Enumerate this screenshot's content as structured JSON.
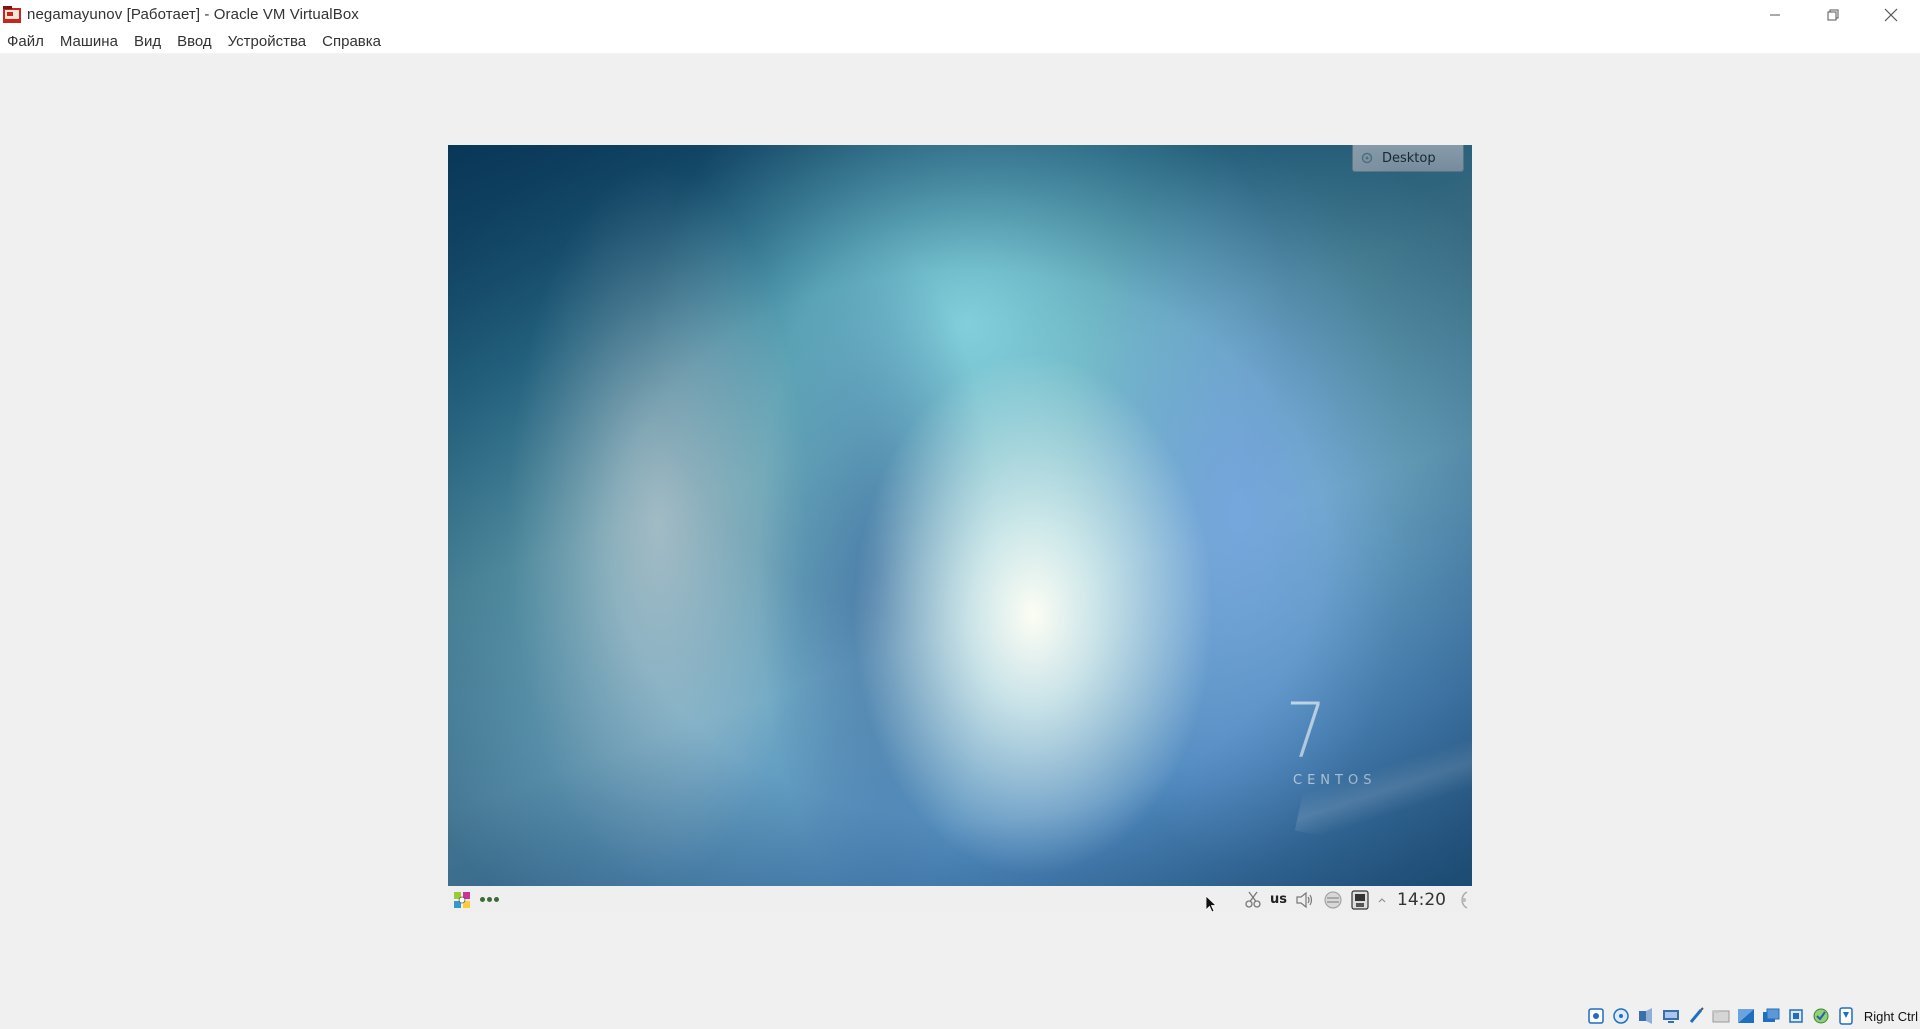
{
  "window": {
    "title": "negamayunov [Работает] - Oracle VM VirtualBox",
    "icon": "virtualbox-icon"
  },
  "menu": {
    "items": [
      "Файл",
      "Машина",
      "Вид",
      "Ввод",
      "Устройства",
      "Справка"
    ]
  },
  "guest": {
    "desktop_button_label": "Desktop",
    "wallpaper_version": "7",
    "wallpaper_brand": "CENTOS",
    "keyboard_layout": "us",
    "clock": "14:20"
  },
  "statusbar": {
    "icons": [
      "hard-disk-icon",
      "optical-drive-icon",
      "audio-icon",
      "network-icon",
      "usb-icon",
      "shared-folders-icon",
      "display-icon",
      "video-capture-icon",
      "cpu-icon",
      "guest-additions-icon",
      "mouse-integration-icon"
    ],
    "host_key": "Right Ctrl"
  },
  "colors": {
    "accent": "#1e6fbf",
    "titlebar": "#ffffff",
    "background": "#f0f0f0"
  }
}
